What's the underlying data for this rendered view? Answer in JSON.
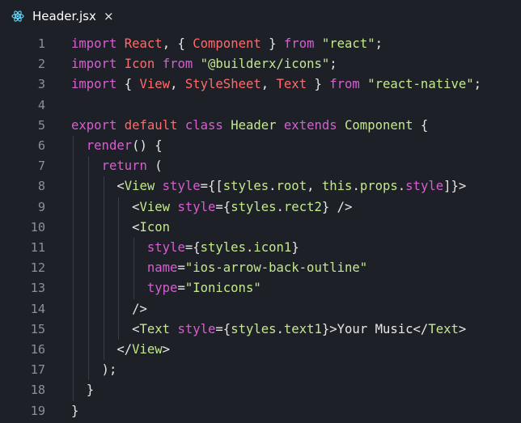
{
  "tab": {
    "label": "Header.jsx",
    "close": "×",
    "icon": "react-atom-icon"
  },
  "colors": {
    "background": "#1e2027",
    "line_number": "#8a8f98",
    "keyword": "#d65fd0",
    "identifier": "#ff6a6a",
    "string": "#c3e88d",
    "plain": "#e6e6e6",
    "react_icon": "#61dafb"
  },
  "lines": [
    {
      "n": "1",
      "tokens": [
        [
          "import",
          "keyword"
        ],
        [
          " ",
          "plain"
        ],
        [
          "React",
          "identifier"
        ],
        [
          ", { ",
          "plain"
        ],
        [
          "Component",
          "identifier"
        ],
        [
          " } ",
          "plain"
        ],
        [
          "from",
          "keyword"
        ],
        [
          " ",
          "plain"
        ],
        [
          "\"react\"",
          "string"
        ],
        [
          ";",
          "plain"
        ]
      ]
    },
    {
      "n": "2",
      "tokens": [
        [
          "import",
          "keyword"
        ],
        [
          " ",
          "plain"
        ],
        [
          "Icon",
          "identifier"
        ],
        [
          " ",
          "plain"
        ],
        [
          "from",
          "keyword"
        ],
        [
          " ",
          "plain"
        ],
        [
          "\"@builderx/icons\"",
          "string"
        ],
        [
          ";",
          "plain"
        ]
      ]
    },
    {
      "n": "3",
      "tokens": [
        [
          "import",
          "keyword"
        ],
        [
          " { ",
          "plain"
        ],
        [
          "View",
          "identifier"
        ],
        [
          ", ",
          "plain"
        ],
        [
          "StyleSheet",
          "identifier"
        ],
        [
          ", ",
          "plain"
        ],
        [
          "Text",
          "identifier"
        ],
        [
          " } ",
          "plain"
        ],
        [
          "from",
          "keyword"
        ],
        [
          " ",
          "plain"
        ],
        [
          "\"react-native\"",
          "string"
        ],
        [
          ";",
          "plain"
        ]
      ]
    },
    {
      "n": "4",
      "tokens": []
    },
    {
      "n": "5",
      "tokens": [
        [
          "export",
          "keyword"
        ],
        [
          " ",
          "plain"
        ],
        [
          "default",
          "identifier"
        ],
        [
          " ",
          "plain"
        ],
        [
          "class",
          "keyword"
        ],
        [
          " ",
          "plain"
        ],
        [
          "Header",
          "string"
        ],
        [
          " ",
          "plain"
        ],
        [
          "extends",
          "keyword"
        ],
        [
          " ",
          "plain"
        ],
        [
          "Component",
          "string"
        ],
        [
          " {",
          "plain"
        ]
      ]
    },
    {
      "n": "6",
      "tokens": [
        [
          "  ",
          "plain"
        ],
        [
          "render",
          "keyword"
        ],
        [
          "() {",
          "plain"
        ]
      ]
    },
    {
      "n": "7",
      "tokens": [
        [
          "    ",
          "plain"
        ],
        [
          "return",
          "keyword"
        ],
        [
          " (",
          "plain"
        ]
      ]
    },
    {
      "n": "8",
      "tokens": [
        [
          "      <",
          "plain"
        ],
        [
          "View",
          "string"
        ],
        [
          " ",
          "plain"
        ],
        [
          "style",
          "keyword"
        ],
        [
          "={[",
          "plain"
        ],
        [
          "styles",
          "string"
        ],
        [
          ".",
          "plain"
        ],
        [
          "root",
          "string"
        ],
        [
          ", ",
          "plain"
        ],
        [
          "this",
          "string"
        ],
        [
          ".",
          "plain"
        ],
        [
          "props",
          "string"
        ],
        [
          ".",
          "plain"
        ],
        [
          "style",
          "keyword"
        ],
        [
          "]}>",
          "plain"
        ]
      ]
    },
    {
      "n": "9",
      "tokens": [
        [
          "        <",
          "plain"
        ],
        [
          "View",
          "string"
        ],
        [
          " ",
          "plain"
        ],
        [
          "style",
          "keyword"
        ],
        [
          "={",
          "plain"
        ],
        [
          "styles",
          "string"
        ],
        [
          ".",
          "plain"
        ],
        [
          "rect2",
          "string"
        ],
        [
          "} />",
          "plain"
        ]
      ]
    },
    {
      "n": "10",
      "tokens": [
        [
          "        <",
          "plain"
        ],
        [
          "Icon",
          "string"
        ]
      ]
    },
    {
      "n": "11",
      "tokens": [
        [
          "          ",
          "plain"
        ],
        [
          "style",
          "keyword"
        ],
        [
          "={",
          "plain"
        ],
        [
          "styles",
          "string"
        ],
        [
          ".",
          "plain"
        ],
        [
          "icon1",
          "string"
        ],
        [
          "}",
          "plain"
        ]
      ]
    },
    {
      "n": "12",
      "tokens": [
        [
          "          ",
          "plain"
        ],
        [
          "name",
          "keyword"
        ],
        [
          "=",
          "plain"
        ],
        [
          "\"ios-arrow-back-outline\"",
          "string"
        ]
      ]
    },
    {
      "n": "13",
      "tokens": [
        [
          "          ",
          "plain"
        ],
        [
          "type",
          "keyword"
        ],
        [
          "=",
          "plain"
        ],
        [
          "\"Ionicons\"",
          "string"
        ]
      ]
    },
    {
      "n": "14",
      "tokens": [
        [
          "        />",
          "plain"
        ]
      ]
    },
    {
      "n": "15",
      "tokens": [
        [
          "        <",
          "plain"
        ],
        [
          "Text",
          "string"
        ],
        [
          " ",
          "plain"
        ],
        [
          "style",
          "keyword"
        ],
        [
          "={",
          "plain"
        ],
        [
          "styles",
          "string"
        ],
        [
          ".",
          "plain"
        ],
        [
          "text1",
          "string"
        ],
        [
          "}>Your Music</",
          "plain"
        ],
        [
          "Text",
          "string"
        ],
        [
          ">",
          "plain"
        ]
      ]
    },
    {
      "n": "16",
      "tokens": [
        [
          "      </",
          "plain"
        ],
        [
          "View",
          "string"
        ],
        [
          ">",
          "plain"
        ]
      ]
    },
    {
      "n": "17",
      "tokens": [
        [
          "    );",
          "plain"
        ]
      ]
    },
    {
      "n": "18",
      "tokens": [
        [
          "  }",
          "plain"
        ]
      ]
    },
    {
      "n": "19",
      "tokens": [
        [
          "}",
          "plain"
        ]
      ]
    }
  ]
}
